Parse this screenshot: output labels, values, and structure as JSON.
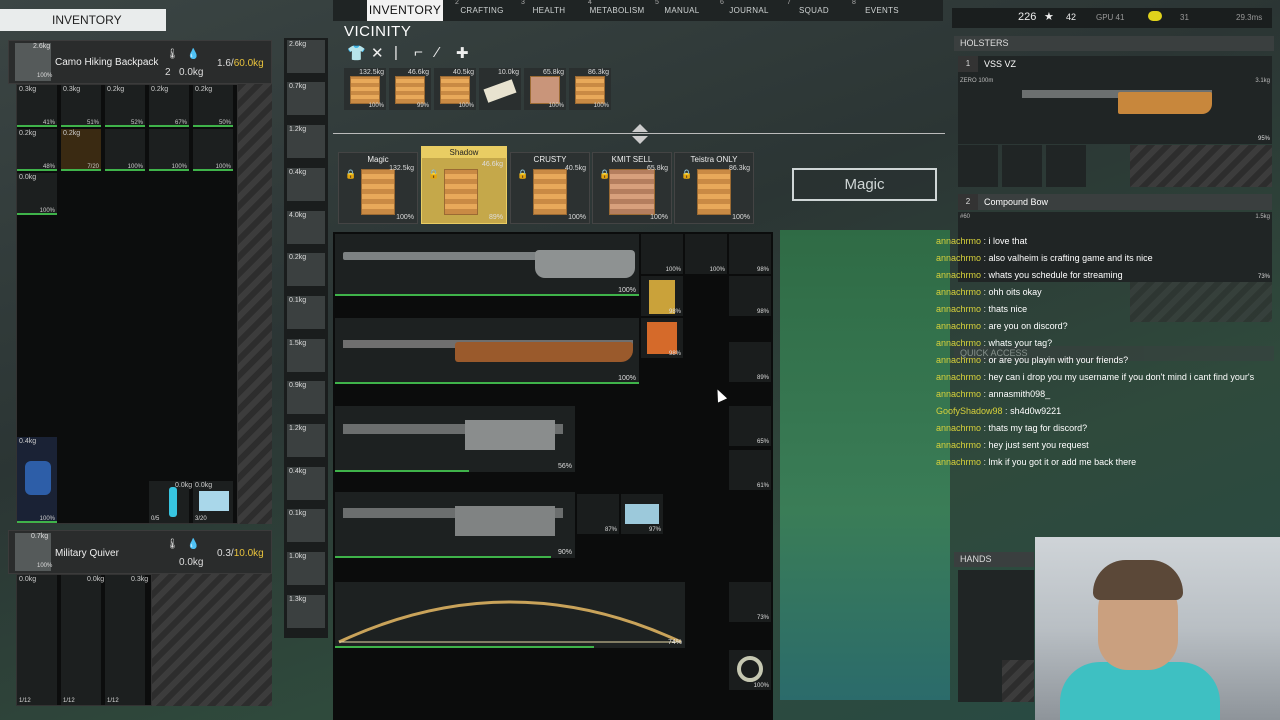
{
  "tabs": [
    {
      "key": "",
      "label": "INVENTORY"
    },
    {
      "key": "2",
      "label": "CRAFTING"
    },
    {
      "key": "3",
      "label": "HEALTH"
    },
    {
      "key": "4",
      "label": "METABOLISM"
    },
    {
      "key": "5",
      "label": "MANUAL"
    },
    {
      "key": "6",
      "label": "JOURNAL"
    },
    {
      "key": "7",
      "label": "SQUAD"
    },
    {
      "key": "8",
      "label": "EVENTS"
    }
  ],
  "left": {
    "title": "INVENTORY",
    "backpack": {
      "name": "Camo Hiking Backpack",
      "weight": "2.6kg",
      "count": "2",
      "water": "0.0kg",
      "capacity_used": "1.6/",
      "capacity_max": "60.0kg",
      "durability": "100%"
    },
    "quiver": {
      "name": "Military Quiver",
      "weight": "0.7kg",
      "water": "0.0kg",
      "capacity_used": "0.3/",
      "capacity_max": "10.0kg",
      "durability": "100%"
    },
    "items": [
      {
        "w": "0.3kg",
        "d": "41%"
      },
      {
        "w": "0.3kg",
        "d": "51%"
      },
      {
        "w": "0.2kg",
        "d": "52%"
      },
      {
        "w": "0.2kg",
        "d": "67%"
      },
      {
        "w": "0.2kg",
        "d": "50%"
      },
      {
        "w": "0.2kg",
        "d": "48%"
      },
      {
        "w": "0.2kg",
        "d": "7/20"
      },
      {
        "w": "",
        "d": "100%"
      },
      {
        "w": "",
        "d": "100%"
      },
      {
        "w": "",
        "d": "100%"
      },
      {
        "w": "0.0kg",
        "d": "100%"
      }
    ],
    "jacket": {
      "w": "0.4kg",
      "d": "100%"
    },
    "bottle": {
      "w": "0.0kg",
      "d": "0/5"
    },
    "pills": {
      "w": "0.0kg",
      "d": "3/20"
    },
    "quiver_items": [
      {
        "w": "0.0kg",
        "d": "1/12"
      },
      {
        "w": "0.0kg",
        "d": "1/12"
      },
      {
        "w": "0.3kg",
        "d": "1/12"
      }
    ]
  },
  "equipment_column": [
    "2.6kg",
    "0.7kg",
    "1.2kg",
    "0.4kg",
    "4.0kg",
    "0.2kg",
    "0.1kg",
    "1.5kg",
    "0.9kg",
    "1.2kg",
    "0.4kg",
    "0.1kg",
    "1.0kg",
    "1.3kg"
  ],
  "vicinity": {
    "title": "VICINITY",
    "crates": [
      {
        "w": "132.5kg",
        "d": "100%"
      },
      {
        "w": "46.6kg",
        "d": "99%"
      },
      {
        "w": "40.5kg",
        "d": "100%"
      },
      {
        "w": "10.0kg",
        "d": ""
      },
      {
        "w": "65.8kg",
        "d": "100%"
      },
      {
        "w": "86.3kg",
        "d": "100%"
      }
    ],
    "containers": [
      {
        "label": "Magic",
        "w": "132.5kg",
        "d": "100%"
      },
      {
        "label": "Shadow",
        "w": "46.6kg",
        "d": "89%"
      },
      {
        "label": "CRUSTY",
        "w": "40.5kg",
        "d": "100%"
      },
      {
        "label": "KMIT SELL",
        "w": "65.8kg",
        "d": "100%"
      },
      {
        "label": "Teistra ONLY",
        "w": "86.3kg",
        "d": "100%"
      }
    ],
    "guns": [
      {
        "d": "100%"
      },
      {
        "d": "100%"
      },
      {
        "d": "56%"
      },
      {
        "d": "90%"
      },
      {
        "d": "74%"
      }
    ],
    "small_items": [
      {
        "d": "100%"
      },
      {
        "d": "100%"
      },
      {
        "d": "98%"
      },
      {
        "d": "98%"
      },
      {
        "d": "98%"
      },
      {
        "d": "98%"
      },
      {
        "d": "89%"
      },
      {
        "d": "65%"
      },
      {
        "d": "61%"
      },
      {
        "d": "87%"
      },
      {
        "d": "97%"
      },
      {
        "d": "73%"
      },
      {
        "d": "100%"
      }
    ],
    "magic_button": "Magic"
  },
  "stats": {
    "count": "226",
    "players": "42",
    "gpu": "GPU 41",
    "gpu_extra": "31",
    "latency": "29.3ms"
  },
  "holsters": {
    "title": "HOLSTERS",
    "slot1_num": "1",
    "slot1_name": "VSS VZ",
    "slot1_sub": "ZERO 100m",
    "slot1_w": "3.1kg",
    "slot1_d": "95%",
    "slot2_num": "2",
    "slot2_name": "Compound Bow",
    "slot2_sub": "#60",
    "slot2_w": "1.5kg",
    "slot2_d": "73%"
  },
  "quick_access": "QUICK ACCESS",
  "hands": "HANDS",
  "chat": [
    {
      "u": "annachrmo",
      "m": "i love that"
    },
    {
      "u": "annachrmo",
      "m": "also valheim is crafting game and its nice"
    },
    {
      "u": "annachrmo",
      "m": "whats you schedule for streaming"
    },
    {
      "u": "annachrmo",
      "m": "ohh oits okay"
    },
    {
      "u": "annachrmo",
      "m": "thats nice"
    },
    {
      "u": "annachrmo",
      "m": "are you on discord?"
    },
    {
      "u": "annachrmo",
      "m": "whats your tag?"
    },
    {
      "u": "annachrmo",
      "m": "or are you playin with your friends?"
    },
    {
      "u": "annachrmo",
      "m": "hey can i drop you my username if you don't mind i cant find your's"
    },
    {
      "u": "annachrmo",
      "m": "annasmith098_"
    },
    {
      "u": "GoofyShadow98",
      "m": "sh4d0w9221"
    },
    {
      "u": "annachrmo",
      "m": "thats my tag for discord?"
    },
    {
      "u": "annachrmo",
      "m": "hey just sent you request"
    },
    {
      "u": "annachrmo",
      "m": "lmk if you got it or add me back there"
    }
  ]
}
